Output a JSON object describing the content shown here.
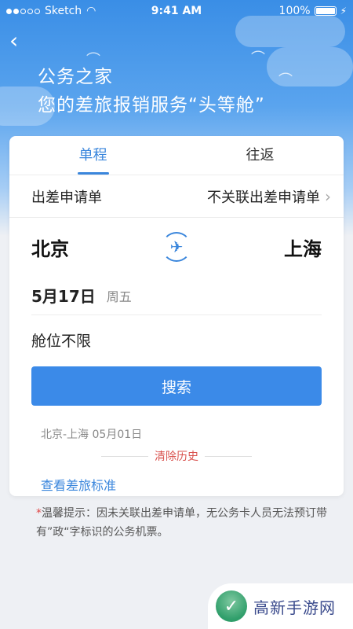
{
  "status_bar": {
    "carrier": "Sketch",
    "time": "9:41 AM",
    "battery": "100%"
  },
  "header": {
    "back_icon": "chevron-left-icon",
    "title": "公务之家",
    "subtitle": "您的差旅报销服务“头等舱”"
  },
  "tabs": [
    {
      "label": "单程",
      "active": true
    },
    {
      "label": "往返",
      "active": false
    }
  ],
  "application": {
    "label": "出差申请单",
    "value": "不关联出差申请单"
  },
  "route": {
    "from": "北京",
    "to": "上海",
    "swap_icon": "plane-swap-icon"
  },
  "date": {
    "value": "5月17日",
    "weekday": "周五"
  },
  "cabin": {
    "value": "舱位不限"
  },
  "search_button": "搜索",
  "history": {
    "items": [
      "北京-上海 05月01日"
    ],
    "clear_label": "清除历史"
  },
  "standard_link": "查看差旅标准",
  "tip": {
    "star": "*",
    "text": "温馨提示：因未关联出差申请单，无公务卡人员无法预订带有”政“字标识的公务机票。"
  },
  "watermark": {
    "text": "高新手游网"
  },
  "colors": {
    "accent": "#3a86dc",
    "button": "#3b8ae8",
    "danger": "#d9534f"
  }
}
